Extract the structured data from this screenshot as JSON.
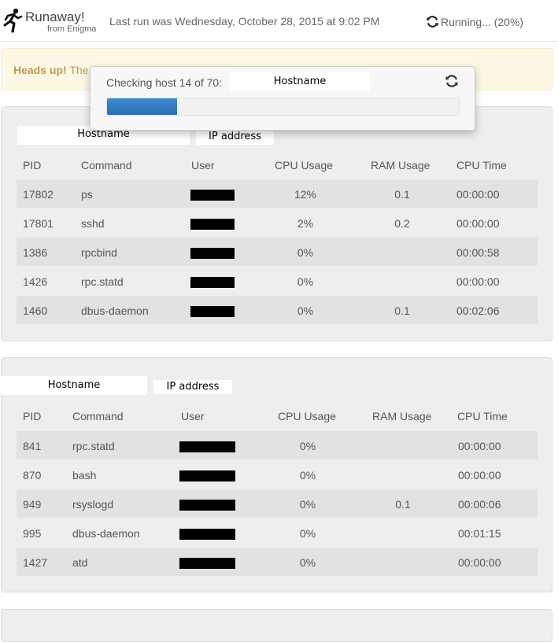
{
  "header": {
    "brand": "Runaway!",
    "brand_sub": "from Enigma",
    "last_run": "Last run was Wednesday, October 28, 2015 at 9:02 PM",
    "status": "Running... (20%)",
    "logo_icon": "running-man-icon",
    "status_icon": "refresh-icon"
  },
  "alert": {
    "strong": "Heads up!",
    "text": " The"
  },
  "progress": {
    "label": "Checking host 14 of 70:",
    "hostname": "Hostname",
    "percent": 20,
    "refresh_icon": "refresh-icon"
  },
  "columns": [
    "PID",
    "Command",
    "User",
    "CPU Usage",
    "RAM Usage",
    "CPU Time"
  ],
  "hosts": [
    {
      "hostname": "Hostname",
      "ip": "IP address",
      "rows": [
        {
          "pid": "17802",
          "command": "ps",
          "cpu": "12%",
          "ram": "0.1",
          "time": "00:00:00"
        },
        {
          "pid": "17801",
          "command": "sshd",
          "cpu": "2%",
          "ram": "0.2",
          "time": "00:00:00"
        },
        {
          "pid": "1386",
          "command": "rpcbind",
          "cpu": "0%",
          "ram": "",
          "time": "00:00:58"
        },
        {
          "pid": "1426",
          "command": "rpc.statd",
          "cpu": "0%",
          "ram": "",
          "time": "00:00:00"
        },
        {
          "pid": "1460",
          "command": "dbus-daemon",
          "cpu": "0%",
          "ram": "0.1",
          "time": "00:02:06"
        }
      ]
    },
    {
      "hostname": "Hostname",
      "ip": "IP address",
      "rows": [
        {
          "pid": "841",
          "command": "rpc.statd",
          "cpu": "0%",
          "ram": "",
          "time": "00:00:00"
        },
        {
          "pid": "870",
          "command": "bash",
          "cpu": "0%",
          "ram": "",
          "time": "00:00:00"
        },
        {
          "pid": "949",
          "command": "rsyslogd",
          "cpu": "0%",
          "ram": "0.1",
          "time": "00:00:06"
        },
        {
          "pid": "995",
          "command": "dbus-daemon",
          "cpu": "0%",
          "ram": "",
          "time": "00:01:15"
        },
        {
          "pid": "1427",
          "command": "atd",
          "cpu": "0%",
          "ram": "",
          "time": "00:00:00"
        }
      ]
    }
  ]
}
